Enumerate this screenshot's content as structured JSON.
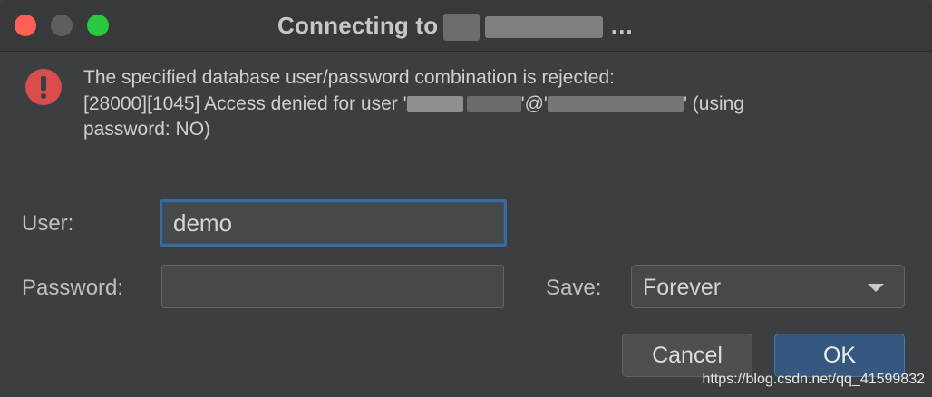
{
  "window": {
    "title_prefix": "Connecting to",
    "title_suffix": "…",
    "traffic_lights": {
      "close": "#ff5f57",
      "minimize": "#5d5e60",
      "maximize": "#28c840"
    }
  },
  "error": {
    "icon": "error-icon",
    "line1": "The specified database user/password combination is rejected:",
    "line2_prefix": "[28000][1045] Access denied for user '",
    "line2_mid": "'@'",
    "line2_suffix": "' (using",
    "line3": "password: NO)"
  },
  "form": {
    "user_label": "User:",
    "user_value": "demo",
    "password_label": "Password:",
    "password_value": "",
    "save_label": "Save:",
    "save_value": "Forever"
  },
  "buttons": {
    "cancel": "Cancel",
    "ok": "OK"
  },
  "watermark": "https://blog.csdn.net/qq_41599832",
  "colors": {
    "accent": "#365880",
    "error": "#d94d4d",
    "background": "#3c3f41"
  }
}
